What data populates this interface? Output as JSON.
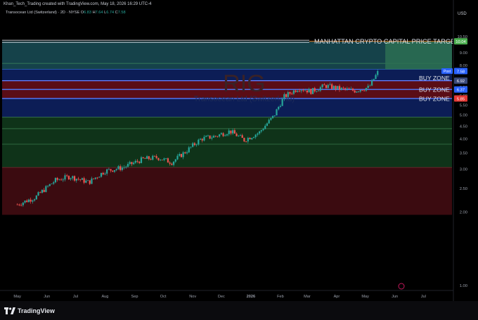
{
  "header": {
    "credit": "Khan_Tech_Trading created with TradingView.com, May 18, 2026 16:29 UTC-4",
    "symbol": "Transocean Ltd (Switzerland) · 2D · NYSE",
    "ohlc": {
      "o_label": "O",
      "o": "6.83",
      "h_label": "H",
      "h": "7.64",
      "l_label": "L",
      "l": "6.74",
      "c_label": "C",
      "c": "7.58"
    }
  },
  "watermark": {
    "ticker": "RIG",
    "name": "Transocean Ltd (Switzerland)"
  },
  "footer": {
    "brand": "TradingView"
  },
  "chart_data": {
    "type": "candlestick",
    "symbol": "RIG",
    "currency": "USD",
    "ylim": [
      0.85,
      11.0
    ],
    "y_scale": "log",
    "y_ticks": [
      1.0,
      2.0,
      2.5,
      3.0,
      3.5,
      4.0,
      4.5,
      5.0,
      5.5,
      6.0,
      6.5,
      7.0,
      7.5,
      8.0,
      9.0,
      10.0,
      10.5
    ],
    "x_ticks": [
      "May",
      "Jun",
      "Jul",
      "Aug",
      "Sep",
      "Oct",
      "Nov",
      "Dec",
      "2026",
      "Feb",
      "Mar",
      "Apr",
      "May",
      "Jun",
      "Jul"
    ],
    "close_points": [
      [
        "2025-05-01",
        2.15
      ],
      [
        "2025-05-20",
        2.3
      ],
      [
        "2025-06-10",
        2.7
      ],
      [
        "2025-06-25",
        2.8
      ],
      [
        "2025-07-15",
        2.65
      ],
      [
        "2025-08-01",
        2.95
      ],
      [
        "2025-08-20",
        3.05
      ],
      [
        "2025-09-10",
        3.3
      ],
      [
        "2025-09-25",
        3.35
      ],
      [
        "2025-10-10",
        3.2
      ],
      [
        "2025-10-25",
        3.55
      ],
      [
        "2025-11-10",
        4.0
      ],
      [
        "2025-11-25",
        4.1
      ],
      [
        "2025-12-10",
        4.3
      ],
      [
        "2025-12-25",
        3.95
      ],
      [
        "2026-01-10",
        4.25
      ],
      [
        "2026-01-25",
        4.95
      ],
      [
        "2026-02-05",
        5.95
      ],
      [
        "2026-02-20",
        6.45
      ],
      [
        "2026-03-05",
        6.25
      ],
      [
        "2026-03-20",
        6.6
      ],
      [
        "2026-04-05",
        6.4
      ],
      [
        "2026-04-20",
        6.3
      ],
      [
        "2026-05-05",
        6.5
      ],
      [
        "2026-05-15",
        7.58
      ]
    ],
    "annotations": [
      {
        "text": "MANHATTAN CRYPTO CAPITAL PRICE TARGET",
        "price": 10.04
      },
      {
        "text": "BUY ZONE",
        "price": 6.92
      },
      {
        "text": "BUY ZONE",
        "price": 6.37
      },
      {
        "text": "BUY ZONE",
        "price": 5.85
      }
    ],
    "zones": [
      {
        "top": 10.04,
        "bottom": 7.7,
        "color": "#15424a"
      },
      {
        "top": 7.7,
        "bottom": 6.92,
        "color": "#0c1d56"
      },
      {
        "top": 6.92,
        "bottom": 5.85,
        "color": "#5a0d16"
      },
      {
        "top": 5.85,
        "bottom": 4.9,
        "color": "#0c1d56"
      },
      {
        "top": 4.9,
        "bottom": 3.05,
        "color": "#0f3319"
      },
      {
        "top": 3.05,
        "bottom": 1.95,
        "color": "#3b0b10"
      }
    ],
    "target_zone": {
      "top": 10.04,
      "bottom": 7.7,
      "color": "#2b6e52"
    },
    "price_labels": [
      {
        "text": "10.04",
        "price": 10.04,
        "color": "#4caf50"
      },
      {
        "text": "7.58",
        "price": 7.58,
        "color": "#2962ff",
        "tag": "Post"
      },
      {
        "text": "6.92",
        "price": 6.92,
        "color": "#3b4a7a"
      },
      {
        "text": "6.37",
        "price": 6.37,
        "color": "#2962ff"
      },
      {
        "text": "5.85",
        "price": 5.85,
        "color": "#e53935"
      }
    ],
    "axis_unit": "USD",
    "colors": {
      "up": "#26a69a",
      "down": "#ef5350",
      "annotation": "#e0e3eb"
    }
  }
}
